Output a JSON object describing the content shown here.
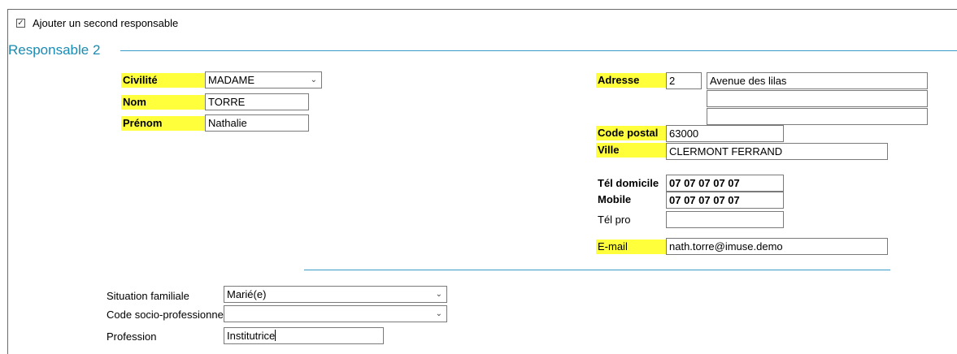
{
  "second_responsible": {
    "checkbox_label": "Ajouter un second responsable",
    "checked": true
  },
  "section_title": "Responsable 2",
  "identity": {
    "civilite_label": "Civilité",
    "civilite_value": "MADAME",
    "nom_label": "Nom",
    "nom_value": "TORRE",
    "prenom_label": "Prénom",
    "prenom_value": "Nathalie"
  },
  "address": {
    "adresse_label": "Adresse",
    "numero": "2",
    "voie_line1": "Avenue des lilas",
    "voie_line2": "",
    "voie_line3": "",
    "code_postal_label": "Code postal",
    "code_postal_value": "63000",
    "ville_label": "Ville",
    "ville_value": "CLERMONT FERRAND"
  },
  "phones": {
    "tel_domicile_label": "Tél domicile",
    "tel_domicile_value": "07 07 07 07 07",
    "mobile_label": "Mobile",
    "mobile_value": "07 07 07 07 07",
    "tel_pro_label": "Tél pro",
    "tel_pro_value": ""
  },
  "email": {
    "label": "E-mail",
    "value": "nath.torre@imuse.demo"
  },
  "family": {
    "situation_label": "Situation familiale",
    "situation_value": "Marié(e)",
    "csp_label": "Code socio-professionnel",
    "csp_value": "",
    "profession_label": "Profession",
    "profession_value": "Institutrice"
  },
  "colors": {
    "accent": "#1a8bb3",
    "highlight": "#ffff3b",
    "divider": "#3a9cc6"
  },
  "icons": {
    "checkbox": "checkmark-icon",
    "dropdown": "chevron-down-icon"
  }
}
